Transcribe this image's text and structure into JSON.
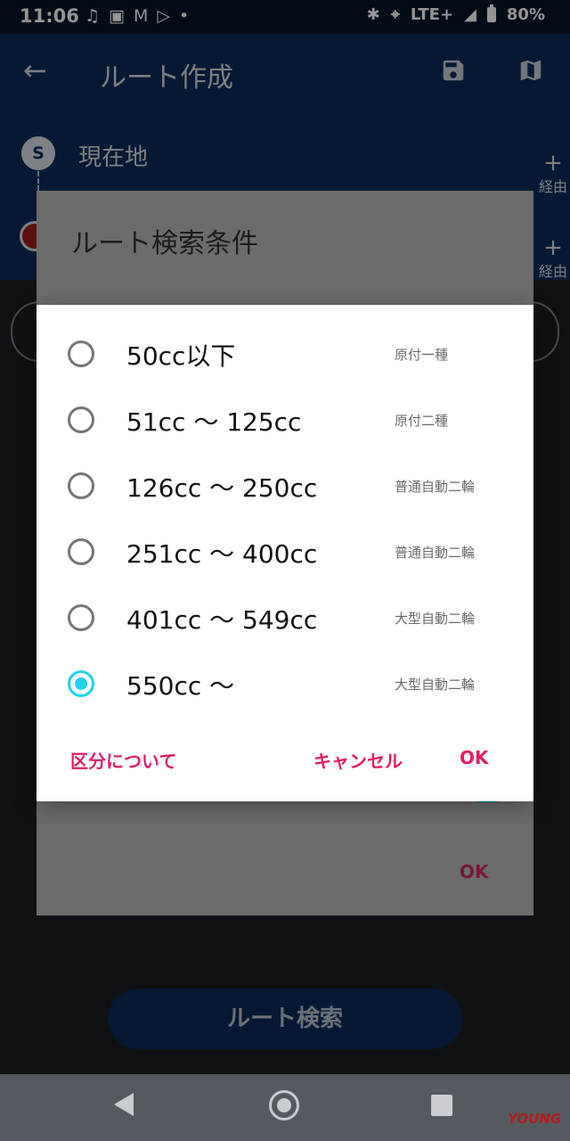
{
  "status_bar": {
    "time": "11:06",
    "network": "LTE+",
    "battery": "80%"
  },
  "header": {
    "title": "ルート作成",
    "back_icon": "arrow-left-icon",
    "save_icon": "save-icon",
    "map_icon": "map-icon"
  },
  "route": {
    "start_marker": "S",
    "start_label": "現在地",
    "via_plus": "+",
    "via_label": "経由"
  },
  "bg_dialog": {
    "title": "ルート検索条件",
    "ok": "OK"
  },
  "cc_dialog": {
    "options": [
      {
        "label": "50cc以下",
        "class": "原付一種",
        "selected": false
      },
      {
        "label": "51cc 〜 125cc",
        "class": "原付二種",
        "selected": false
      },
      {
        "label": "126cc 〜 250cc",
        "class": "普通自動二輪",
        "selected": false
      },
      {
        "label": "251cc 〜 400cc",
        "class": "普通自動二輪",
        "selected": false
      },
      {
        "label": "401cc 〜 549cc",
        "class": "大型自動二輪",
        "selected": false
      },
      {
        "label": "550cc 〜",
        "class": "大型自動二輪",
        "selected": true
      }
    ],
    "about": "区分について",
    "cancel": "キャンセル",
    "ok": "OK",
    "accent_color": "#e21d66",
    "radio_color": "#1fd2e8"
  },
  "route_search_button": "ルート検索",
  "watermark": "YOUNG"
}
